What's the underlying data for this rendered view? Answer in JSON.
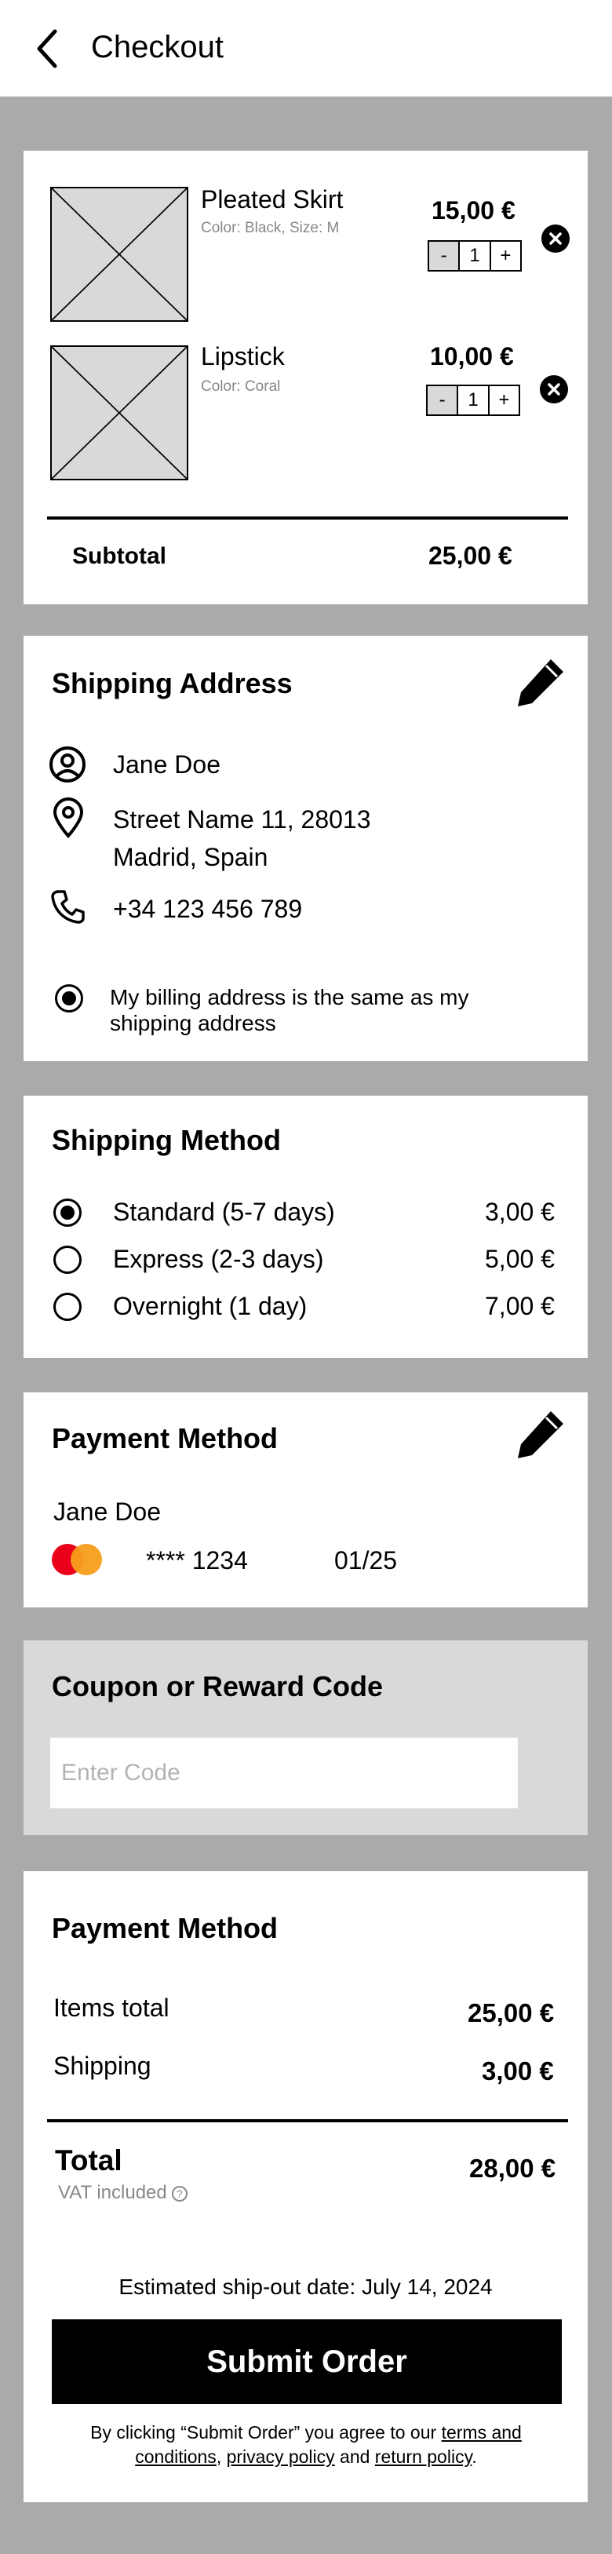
{
  "header": {
    "title": "Checkout",
    "back_icon": "back-arrow-icon"
  },
  "cart": {
    "items": [
      {
        "name": "Pleated Skirt",
        "meta": "Color: Black, Size: M",
        "price": "15,00 €",
        "qty": "1",
        "minus": "-",
        "plus": "+"
      },
      {
        "name": "Lipstick",
        "meta": "Color: Coral",
        "price": "10,00 €",
        "qty": "1",
        "minus": "-",
        "plus": "+"
      }
    ],
    "subtotal_label": "Subtotal",
    "subtotal_value": "25,00 €"
  },
  "shipping_address": {
    "title": "Shipping Address",
    "name": "Jane Doe",
    "street": "Street Name 11, 28013",
    "city": "Madrid, Spain",
    "phone": "+34 123 456 789",
    "billing_same": "My billing address is the same as my shipping address",
    "billing_checked": true
  },
  "shipping_method": {
    "title": "Shipping Method",
    "options": [
      {
        "label": "Standard (5-7 days)",
        "price": "3,00 €",
        "selected": true
      },
      {
        "label": "Express (2-3 days)",
        "price": "5,00 €",
        "selected": false
      },
      {
        "label": "Overnight (1 day)",
        "price": "7,00 €",
        "selected": false
      }
    ]
  },
  "payment_method": {
    "title": "Payment Method",
    "holder": "Jane Doe",
    "card_number": "**** 1234",
    "expiry": "01/25",
    "brand_icon": "mastercard-icon"
  },
  "coupon": {
    "title": "Coupon or Reward Code",
    "placeholder": "Enter Code"
  },
  "summary": {
    "title": "Payment Method",
    "items_total_label": "Items total",
    "items_total_value": "25,00 €",
    "shipping_label": "Shipping",
    "shipping_value": "3,00 €",
    "total_label": "Total",
    "vat_note": "VAT included",
    "total_value": "28,00 €",
    "ship_date": "Estimated ship-out date: July 14, 2024",
    "submit_label": "Submit Order",
    "legal_prefix": "By clicking “Submit Order” you agree to our ",
    "terms_link": "terms and conditions",
    "comma": ", ",
    "privacy_link": "privacy policy",
    "and": " and ",
    "return_link": "return policy",
    "period": "."
  },
  "colors": {
    "background": "#aaaaaa",
    "card": "#ffffff",
    "coupon_card": "#d9d9d9",
    "button": "#000000",
    "mc_red": "#eb001b",
    "mc_orange": "#f79e1b"
  }
}
